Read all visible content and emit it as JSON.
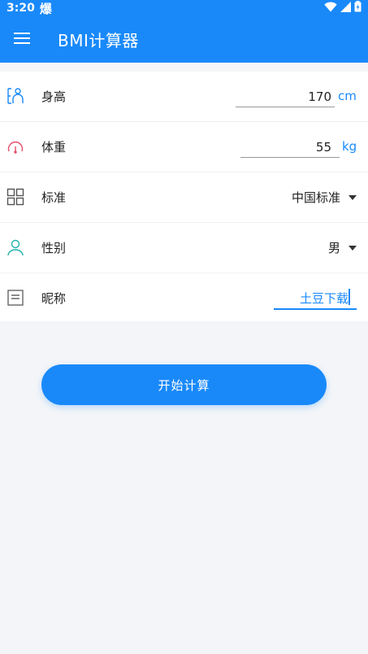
{
  "status_bar": {
    "time": "3:20",
    "notification_glyph": "爆"
  },
  "app_bar": {
    "title": "BMI计算器",
    "menu_icon": "menu-icon"
  },
  "form": {
    "height": {
      "label": "身高",
      "value": "170",
      "unit": "cm",
      "icon": "person-height-icon",
      "icon_color": "#1989fa"
    },
    "weight": {
      "label": "体重",
      "value": "55",
      "unit": "kg",
      "icon": "gauge-icon",
      "icon_color": "#e54d6b"
    },
    "standard": {
      "label": "标准",
      "value": "中国标准",
      "icon": "grid-icon",
      "icon_color": "#555555"
    },
    "gender": {
      "label": "性别",
      "value": "男",
      "icon": "user-icon",
      "icon_color": "#20b2aa"
    },
    "nickname": {
      "label": "昵称",
      "value": "土豆下载",
      "icon": "list-icon",
      "icon_color": "#666666"
    }
  },
  "actions": {
    "start_label": "开始计算"
  },
  "colors": {
    "primary": "#1989fa",
    "background": "#f3f5f9"
  }
}
